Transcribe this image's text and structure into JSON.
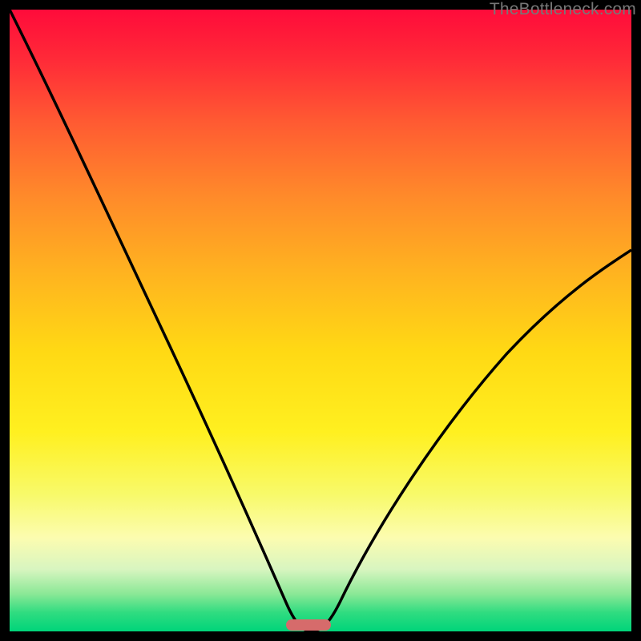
{
  "attribution": "TheBottleneck.com",
  "colors": {
    "top": "#ff0b3a",
    "mid": "#ffd914",
    "bottom": "#00d47a",
    "curve": "#000000",
    "marker": "#d66b6b",
    "frame": "#000000"
  },
  "chart_data": {
    "type": "line",
    "title": "",
    "xlabel": "",
    "ylabel": "",
    "xlim": [
      0,
      100
    ],
    "ylim": [
      0,
      100
    ],
    "grid": false,
    "legend": false,
    "series": [
      {
        "name": "left-branch",
        "x": [
          0,
          5,
          10,
          15,
          20,
          25,
          30,
          35,
          40,
          43,
          46,
          48
        ],
        "values": [
          100,
          90,
          80,
          70,
          59,
          47,
          35,
          24,
          13,
          6,
          2,
          0
        ]
      },
      {
        "name": "right-branch",
        "x": [
          48,
          51,
          55,
          60,
          65,
          70,
          75,
          80,
          85,
          90,
          95,
          100
        ],
        "values": [
          0,
          2,
          6,
          12,
          19,
          26,
          33,
          40,
          47,
          53,
          58,
          62
        ]
      }
    ],
    "marker": {
      "x_start": 45,
      "x_end": 52,
      "y": 0
    },
    "background_gradient": {
      "direction": "vertical",
      "stops": [
        {
          "pos": 0,
          "color": "#ff0b3a"
        },
        {
          "pos": 55,
          "color": "#ffd914"
        },
        {
          "pos": 100,
          "color": "#00d47a"
        }
      ]
    }
  }
}
